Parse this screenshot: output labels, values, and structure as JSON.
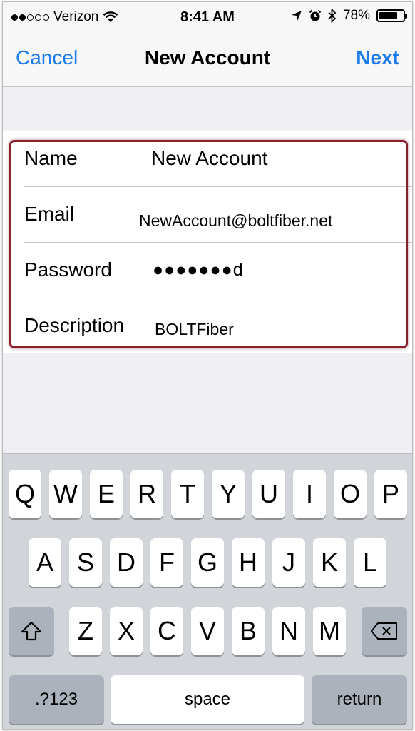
{
  "status_bar": {
    "carrier": "Verizon",
    "time": "8:41 AM",
    "battery": "78%",
    "battery_level": 0.78,
    "signal_bars_filled": 2,
    "signal_bars_total": 5,
    "icons": [
      "wifi-icon",
      "location-arrow-icon",
      "alarm-icon",
      "bluetooth-icon",
      "battery-icon"
    ]
  },
  "nav": {
    "cancel": "Cancel",
    "title": "New Account",
    "next": "Next"
  },
  "form": {
    "rows": [
      {
        "label": "Name",
        "value": "New Account"
      },
      {
        "label": "Email",
        "value": "NewAccount@boltfiber.net"
      },
      {
        "label": "Password",
        "value": "●●●●●●●d"
      },
      {
        "label": "Description",
        "value": "BOLTFiber"
      }
    ]
  },
  "keyboard": {
    "row1": [
      "Q",
      "W",
      "E",
      "R",
      "T",
      "Y",
      "U",
      "I",
      "O",
      "P"
    ],
    "row2": [
      "A",
      "S",
      "D",
      "F",
      "G",
      "H",
      "J",
      "K",
      "L"
    ],
    "row3": [
      "Z",
      "X",
      "C",
      "V",
      "B",
      "N",
      "M"
    ],
    "numbers_key": ".?123",
    "space_key": "space",
    "return_key": "return"
  },
  "colors": {
    "accent": "#1b7bea",
    "highlight_border": "#8b1f2b"
  }
}
